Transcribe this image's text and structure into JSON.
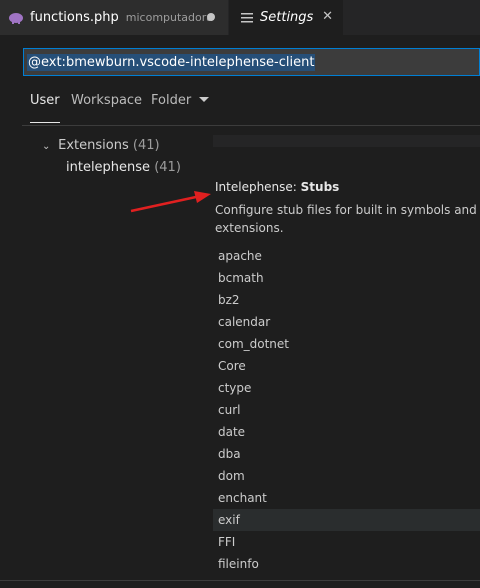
{
  "tabs": [
    {
      "title": "functions.php",
      "description": "micomputadora",
      "dirty": true
    },
    {
      "title": "Settings"
    }
  ],
  "search": {
    "value": "@ext:bmewburn.vscode-intelephense-client"
  },
  "scopes": [
    "User",
    "Workspace",
    "Folder"
  ],
  "toc": {
    "extensions": {
      "label": "Extensions",
      "count": "(41)"
    },
    "intelephense": {
      "label": "intelephense",
      "count": "(41)"
    }
  },
  "setting": {
    "category": "Intelephense: ",
    "name": "Stubs",
    "description_line1": "Configure stub files for built in symbols and co",
    "description_line2": "extensions.",
    "items": [
      "apache",
      "bcmath",
      "bz2",
      "calendar",
      "com_dotnet",
      "Core",
      "ctype",
      "curl",
      "date",
      "dba",
      "dom",
      "enchant",
      "exif",
      "FFI",
      "fileinfo"
    ],
    "selected_index": 12
  },
  "colors": {
    "accent": "#007fd4",
    "annotation_arrow": "#e02020"
  }
}
